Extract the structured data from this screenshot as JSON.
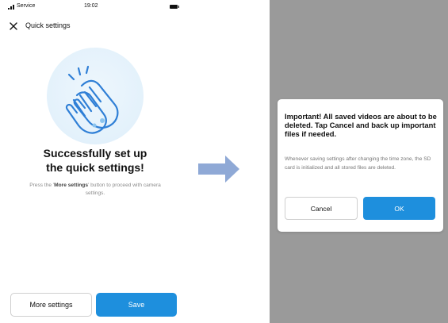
{
  "status_bar": {
    "carrier": "Service",
    "time": "19:02"
  },
  "header": {
    "title": "Quick settings"
  },
  "success": {
    "title_line1": "Successfully set up",
    "title_line2": "the quick settings!",
    "description_prefix": "Press the '",
    "description_bold": "More settings",
    "description_suffix": "' button to proceed with camera settings."
  },
  "buttons": {
    "more_settings": "More settings",
    "save": "Save"
  },
  "dialog": {
    "title": "Important!  All saved videos are about to be deleted. Tap Cancel and back up important files if needed.",
    "body": "Whenever saving settings after changing the time zone, the SD card is initialized and all stored files are deleted.",
    "cancel": "Cancel",
    "ok": "OK"
  },
  "colors": {
    "accent": "#1e8fdd",
    "hero_circle": "#e3f1fb",
    "overlay": "#9a9a9a",
    "arrow": "#8fa9d6"
  },
  "icons": {
    "close": "close-icon",
    "hero": "clapping-hands-icon",
    "arrow": "arrow-right-icon",
    "signal": "signal-icon",
    "battery": "battery-icon"
  }
}
